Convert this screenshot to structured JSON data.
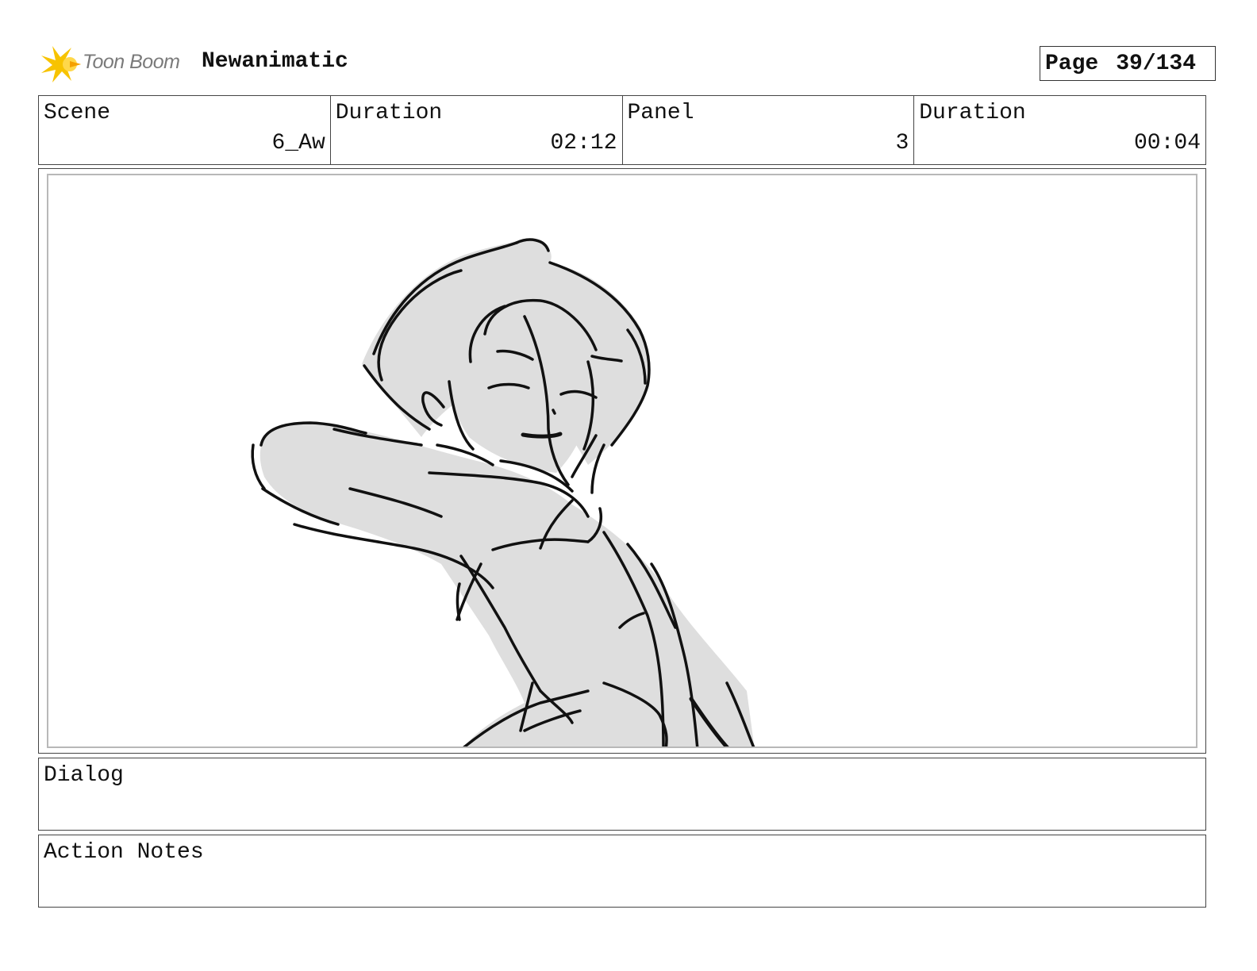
{
  "header": {
    "brand": "Toon Boom",
    "project_title": "Newanimatic",
    "page_label": "Page",
    "page_value": "39/134"
  },
  "info": {
    "scene_label": "Scene",
    "scene_value": "6_Aw",
    "scene_duration_label": "Duration",
    "scene_duration_value": "02:12",
    "panel_label": "Panel",
    "panel_value": "3",
    "panel_duration_label": "Duration",
    "panel_duration_value": "00:04"
  },
  "panel": {
    "image": "sketch-character-reaching"
  },
  "notes": {
    "dialog_label": "Dialog",
    "dialog_text": "",
    "action_label": "Action Notes",
    "action_text": ""
  },
  "colors": {
    "sketch_fill": "#dedede",
    "sketch_stroke": "#111111",
    "logo_accent": "#f5b800"
  }
}
